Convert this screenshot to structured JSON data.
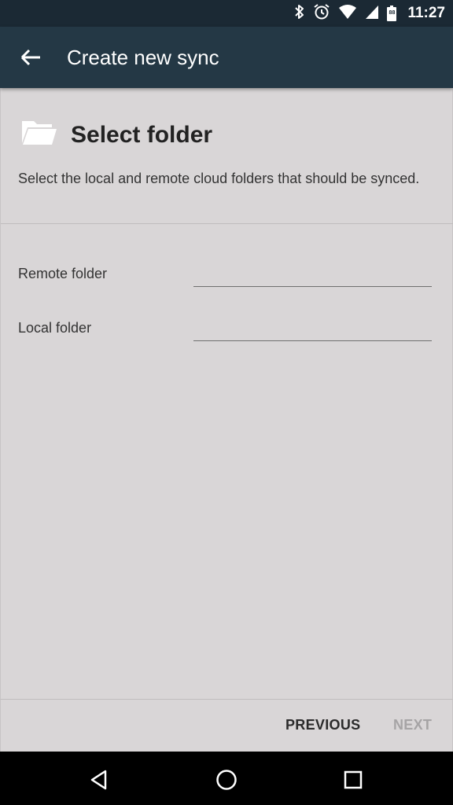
{
  "status_bar": {
    "time": "11:27",
    "battery_level": "88",
    "icons": [
      "bluetooth-icon",
      "alarm-icon",
      "wifi-icon",
      "cell-signal-icon",
      "battery-icon"
    ]
  },
  "app_bar": {
    "title": "Create new sync",
    "back_icon": "arrow-back-icon"
  },
  "section": {
    "icon": "folder-open-icon",
    "title": "Select folder",
    "description": "Select the local and remote cloud folders that should be synced."
  },
  "form": {
    "remote_folder": {
      "label": "Remote folder",
      "value": ""
    },
    "local_folder": {
      "label": "Local folder",
      "value": ""
    }
  },
  "buttons": {
    "previous": "PREVIOUS",
    "next": "NEXT",
    "next_enabled": false
  },
  "navigation": [
    "back-nav-icon",
    "home-nav-icon",
    "recents-nav-icon"
  ],
  "colors": {
    "status_bar": "#1b2934",
    "app_bar": "#243845",
    "background": "#d9d6d7",
    "text_primary": "#2b2b2b",
    "text_disabled": "#a6a4a5"
  }
}
